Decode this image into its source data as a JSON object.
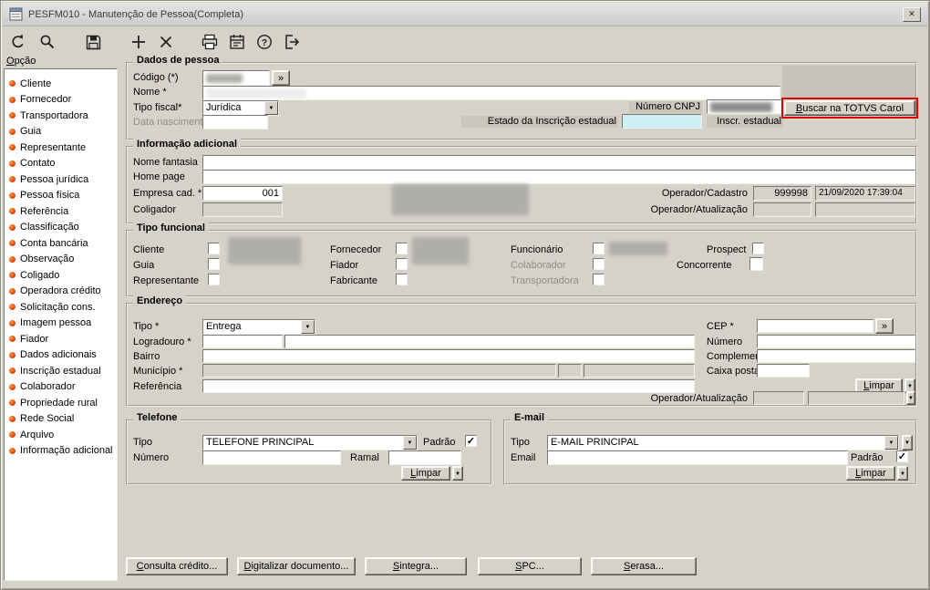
{
  "window": {
    "title": "PESFM010 - Manutenção de Pessoa(Completa)"
  },
  "icons": {
    "close": "✕",
    "dropdown_arrow": "▼",
    "double_chevron": "»",
    "check": "✓",
    "toolbar": [
      "undo",
      "search",
      "save",
      "add",
      "delete",
      "print",
      "agenda",
      "help",
      "exit"
    ]
  },
  "colors": {
    "face": "#d5d2ca",
    "highlight_red": "#e00000",
    "field_blue": "#cdeff6",
    "bullet_orange": "#e04a00"
  },
  "sidebar": {
    "label": "Opção",
    "items": [
      "Cliente",
      "Fornecedor",
      "Transportadora",
      "Guia",
      "Representante",
      "Contato",
      "Pessoa jurídica",
      "Pessoa física",
      "Referência",
      "Classificação",
      "Conta bancária",
      "Observação",
      "Coligado",
      "Operadora crédito",
      "Solicitação cons.",
      "Imagem pessoa",
      "Fiador",
      "Dados adicionais",
      "Inscrição estadual",
      "Colaborador",
      "Propriedade rural",
      "Rede Social",
      "Arquivo",
      "Informação adicional"
    ]
  },
  "dados_pessoa": {
    "legend": "Dados de pessoa",
    "codigo_label": "Código (*)",
    "nome_label": "Nome *",
    "tipo_fiscal_label": "Tipo fiscal*",
    "tipo_fiscal_value": "Jurídica",
    "data_nascimento_label": "Data nascimento",
    "estado_inscricao_label": "Estado da Inscrição estadual",
    "numero_cnpj_label": "Número CNPJ",
    "inscr_estadual_label": "Inscr. estadual",
    "buscar_carol_button": "Buscar na TOTVS Carol"
  },
  "info_adicional": {
    "legend": "Informação adicional",
    "nome_fantasia_label": "Nome fantasia",
    "home_page_label": "Home page",
    "empresa_cad_label": "Empresa cad. *",
    "empresa_cad_value": "001",
    "coligador_label": "Coligador",
    "operador_cadastro_label": "Operador/Cadastro",
    "operador_cadastro_value": "999998",
    "cadastro_datetime": "21/09/2020 17:39:04",
    "operador_atualizacao_label": "Operador/Atualização"
  },
  "tipo_funcional": {
    "legend": "Tipo funcional",
    "cliente": "Cliente",
    "guia": "Guia",
    "representante": "Representante",
    "fornecedor": "Fornecedor",
    "fiador": "Fiador",
    "fabricante": "Fabricante",
    "funcionario": "Funcionário",
    "colaborador": "Colaborador",
    "transportadora": "Transportadora",
    "prospect": "Prospect",
    "concorrente": "Concorrente",
    "checked": {
      "cliente": false,
      "guia": false,
      "representante": false,
      "fornecedor": false,
      "fiador": false,
      "fabricante": false,
      "funcionario": false,
      "colaborador": false,
      "transportadora": false,
      "prospect": false,
      "concorrente": false
    }
  },
  "endereco": {
    "legend": "Endereço",
    "tipo_label": "Tipo *",
    "tipo_value": "Entrega",
    "logradouro_label": "Logradouro *",
    "bairro_label": "Bairro",
    "municipio_label": "Município *",
    "referencia_label": "Referência",
    "cep_label": "CEP *",
    "numero_label": "Número",
    "complemento_label": "Complemento",
    "caixa_postal_label": "Caixa postal",
    "limpar_button": "Limpar",
    "operador_atualizacao_label": "Operador/Atualização"
  },
  "telefone": {
    "legend": "Telefone",
    "tipo_label": "Tipo",
    "tipo_value": "TELEFONE PRINCIPAL",
    "padrao_label": "Padrão",
    "padrao_checked": true,
    "numero_label": "Número",
    "ramal_label": "Ramal",
    "limpar_button": "Limpar"
  },
  "email": {
    "legend": "E-mail",
    "tipo_label": "Tipo",
    "tipo_value": "E-MAIL PRINCIPAL",
    "email_label": "Email",
    "padrao_label": "Padrão",
    "padrao_checked": true,
    "limpar_button": "Limpar"
  },
  "bottom_buttons": [
    "Consulta crédito...",
    "Digitalizar documento...",
    "Sintegra...",
    "SPC...",
    "Serasa..."
  ]
}
